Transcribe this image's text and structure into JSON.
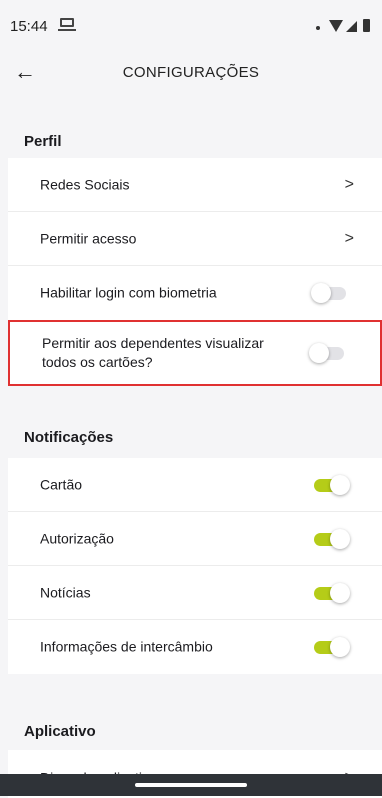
{
  "status_bar": {
    "time": "15:44"
  },
  "header": {
    "title": "CONFIGURAÇÕES"
  },
  "profile": {
    "title": "Perfil",
    "items": [
      {
        "label": "Redes Sociais"
      },
      {
        "label": "Permitir acesso"
      },
      {
        "label": "Habilitar login com biometria",
        "enabled": false
      },
      {
        "label": "Permitir aos dependentes visualizar todos os cartões?",
        "enabled": false
      }
    ]
  },
  "notifications": {
    "title": "Notificações",
    "items": [
      {
        "label": "Cartão",
        "enabled": true
      },
      {
        "label": "Autorização",
        "enabled": true
      },
      {
        "label": "Notícias",
        "enabled": true
      },
      {
        "label": "Informações de intercâmbio",
        "enabled": true
      }
    ]
  },
  "app_section": {
    "title": "Aplicativo",
    "items": [
      {
        "label": "Dicas do aplicativo"
      }
    ]
  },
  "colors": {
    "toggle_on": "#b5cc18",
    "highlight": "#e03131"
  }
}
